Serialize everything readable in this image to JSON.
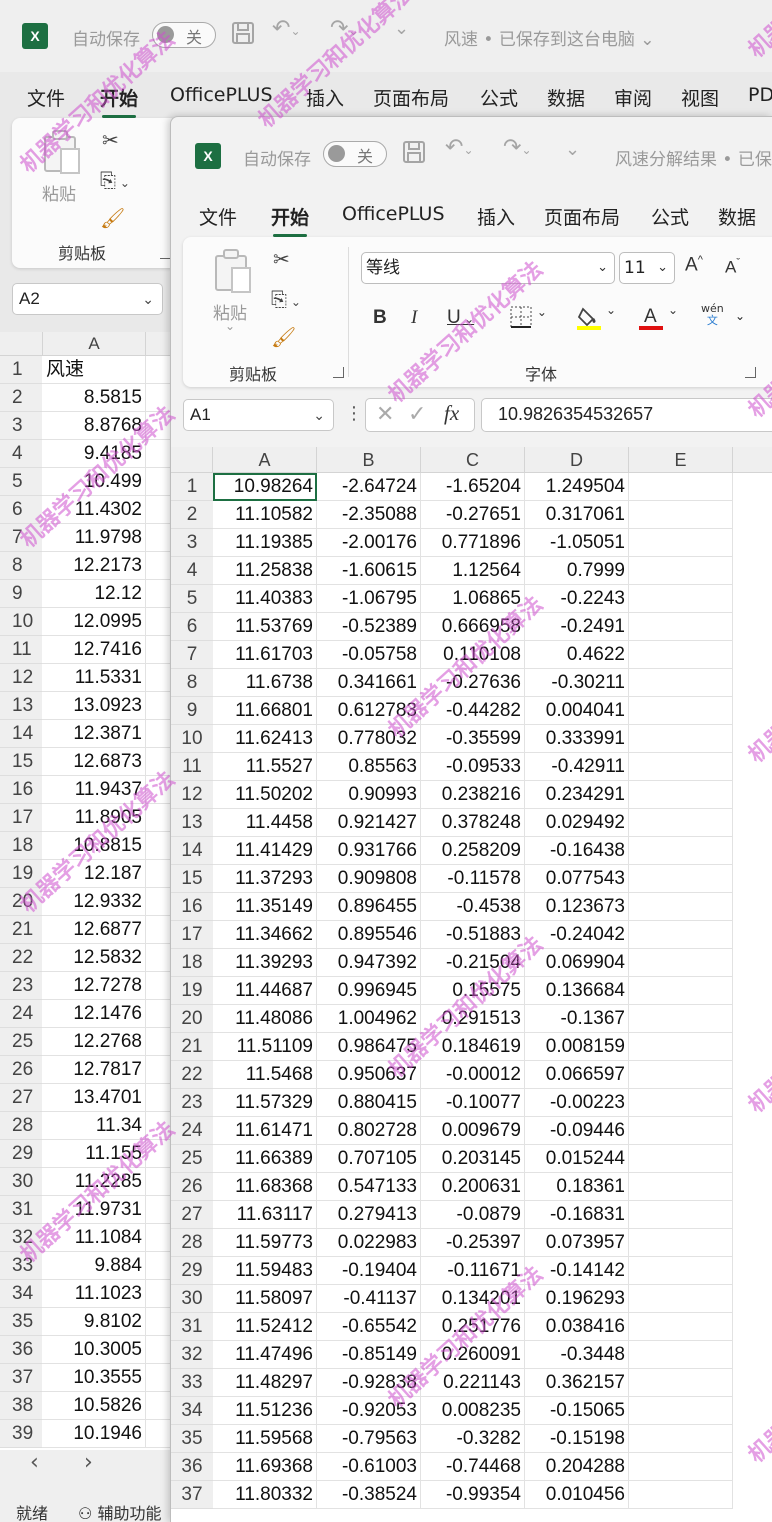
{
  "colors": {
    "excel_green": "#1d6f42",
    "watermark": "#cd50cd"
  },
  "back_window": {
    "autosave_label": "自动保存",
    "autosave_state": "关",
    "doc_title": "风速 • 已保存到这台电脑",
    "menu": [
      "文件",
      "开始",
      "OfficePLUS",
      "插入",
      "页面布局",
      "公式",
      "数据",
      "审阅",
      "视图",
      "PD"
    ],
    "paste_label": "粘贴",
    "clipboard_label": "剪贴板",
    "namebox": "A2",
    "col_header": "A",
    "rows": [
      {
        "n": "1",
        "v": "风速"
      },
      {
        "n": "2",
        "v": "8.5815"
      },
      {
        "n": "3",
        "v": "8.8768"
      },
      {
        "n": "4",
        "v": "9.4185"
      },
      {
        "n": "5",
        "v": "10.499"
      },
      {
        "n": "6",
        "v": "11.4302"
      },
      {
        "n": "7",
        "v": "11.9798"
      },
      {
        "n": "8",
        "v": "12.2173"
      },
      {
        "n": "9",
        "v": "12.12"
      },
      {
        "n": "10",
        "v": "12.0995"
      },
      {
        "n": "11",
        "v": "12.7416"
      },
      {
        "n": "12",
        "v": "11.5331"
      },
      {
        "n": "13",
        "v": "13.0923"
      },
      {
        "n": "14",
        "v": "12.3871"
      },
      {
        "n": "15",
        "v": "12.6873"
      },
      {
        "n": "16",
        "v": "11.9437"
      },
      {
        "n": "17",
        "v": "11.8905"
      },
      {
        "n": "18",
        "v": "10.8815"
      },
      {
        "n": "19",
        "v": "12.187"
      },
      {
        "n": "20",
        "v": "12.9332"
      },
      {
        "n": "21",
        "v": "12.6877"
      },
      {
        "n": "22",
        "v": "12.5832"
      },
      {
        "n": "23",
        "v": "12.7278"
      },
      {
        "n": "24",
        "v": "12.1476"
      },
      {
        "n": "25",
        "v": "12.2768"
      },
      {
        "n": "26",
        "v": "12.7817"
      },
      {
        "n": "27",
        "v": "13.4701"
      },
      {
        "n": "28",
        "v": "11.34"
      },
      {
        "n": "29",
        "v": "11.155"
      },
      {
        "n": "30",
        "v": "11.2285"
      },
      {
        "n": "31",
        "v": "11.9731"
      },
      {
        "n": "32",
        "v": "11.1084"
      },
      {
        "n": "33",
        "v": "9.884"
      },
      {
        "n": "34",
        "v": "11.1023"
      },
      {
        "n": "35",
        "v": "9.8102"
      },
      {
        "n": "36",
        "v": "10.3005"
      },
      {
        "n": "37",
        "v": "10.3555"
      },
      {
        "n": "38",
        "v": "10.5826"
      },
      {
        "n": "39",
        "v": "10.1946"
      }
    ],
    "status_ready": "就绪",
    "status_accessibility": "辅助功能"
  },
  "front_window": {
    "autosave_label": "自动保存",
    "autosave_state": "关",
    "doc_title": "风速分解结果 • 已保",
    "menu": [
      "文件",
      "开始",
      "OfficePLUS",
      "插入",
      "页面布局",
      "公式",
      "数据"
    ],
    "paste_label": "粘贴",
    "clipboard_label": "剪贴板",
    "font_label": "字体",
    "font_name": "等线",
    "font_size": "11",
    "phonetic_top": "wén",
    "phonetic_bottom": "文",
    "namebox": "A1",
    "fx_label": "fx",
    "formula_value": "10.9826354532657",
    "columns": [
      "A",
      "B",
      "C",
      "D",
      "E"
    ],
    "rows": [
      [
        "1",
        "10.98264",
        "-2.64724",
        "-1.65204",
        "1.249504"
      ],
      [
        "2",
        "11.10582",
        "-2.35088",
        "-0.27651",
        "0.317061"
      ],
      [
        "3",
        "11.19385",
        "-2.00176",
        "0.771896",
        "-1.05051"
      ],
      [
        "4",
        "11.25838",
        "-1.60615",
        "1.12564",
        "0.7999"
      ],
      [
        "5",
        "11.40383",
        "-1.06795",
        "1.06865",
        "-0.2243"
      ],
      [
        "6",
        "11.53769",
        "-0.52389",
        "0.666958",
        "-0.2491"
      ],
      [
        "7",
        "11.61703",
        "-0.05758",
        "0.110108",
        "0.4622"
      ],
      [
        "8",
        "11.6738",
        "0.341661",
        "-0.27636",
        "-0.30211"
      ],
      [
        "9",
        "11.66801",
        "0.612783",
        "-0.44282",
        "0.004041"
      ],
      [
        "10",
        "11.62413",
        "0.778032",
        "-0.35599",
        "0.333991"
      ],
      [
        "11",
        "11.5527",
        "0.85563",
        "-0.09533",
        "-0.42911"
      ],
      [
        "12",
        "11.50202",
        "0.90993",
        "0.238216",
        "0.234291"
      ],
      [
        "13",
        "11.4458",
        "0.921427",
        "0.378248",
        "0.029492"
      ],
      [
        "14",
        "11.41429",
        "0.931766",
        "0.258209",
        "-0.16438"
      ],
      [
        "15",
        "11.37293",
        "0.909808",
        "-0.11578",
        "0.077543"
      ],
      [
        "16",
        "11.35149",
        "0.896455",
        "-0.4538",
        "0.123673"
      ],
      [
        "17",
        "11.34662",
        "0.895546",
        "-0.51883",
        "-0.24042"
      ],
      [
        "18",
        "11.39293",
        "0.947392",
        "-0.21504",
        "0.069904"
      ],
      [
        "19",
        "11.44687",
        "0.996945",
        "0.15575",
        "0.136684"
      ],
      [
        "20",
        "11.48086",
        "1.004962",
        "0.291513",
        "-0.1367"
      ],
      [
        "21",
        "11.51109",
        "0.986475",
        "0.184619",
        "0.008159"
      ],
      [
        "22",
        "11.5468",
        "0.950637",
        "-0.00012",
        "0.066597"
      ],
      [
        "23",
        "11.57329",
        "0.880415",
        "-0.10077",
        "-0.00223"
      ],
      [
        "24",
        "11.61471",
        "0.802728",
        "0.009679",
        "-0.09446"
      ],
      [
        "25",
        "11.66389",
        "0.707105",
        "0.203145",
        "0.015244"
      ],
      [
        "26",
        "11.68368",
        "0.547133",
        "0.200631",
        "0.18361"
      ],
      [
        "27",
        "11.63117",
        "0.279413",
        "-0.0879",
        "-0.16831"
      ],
      [
        "28",
        "11.59773",
        "0.022983",
        "-0.25397",
        "0.073957"
      ],
      [
        "29",
        "11.59483",
        "-0.19404",
        "-0.11671",
        "-0.14142"
      ],
      [
        "30",
        "11.58097",
        "-0.41137",
        "0.134201",
        "0.196293"
      ],
      [
        "31",
        "11.52412",
        "-0.65542",
        "0.251776",
        "0.038416"
      ],
      [
        "32",
        "11.47496",
        "-0.85149",
        "0.260091",
        "-0.3448"
      ],
      [
        "33",
        "11.48297",
        "-0.92838",
        "0.221143",
        "0.362157"
      ],
      [
        "34",
        "11.51236",
        "-0.92053",
        "0.008235",
        "-0.15065"
      ],
      [
        "35",
        "11.59568",
        "-0.79563",
        "-0.3282",
        "-0.15198"
      ],
      [
        "36",
        "11.69368",
        "-0.61003",
        "-0.74468",
        "0.204288"
      ],
      [
        "37",
        "11.80332",
        "-0.38524",
        "-0.99354",
        "0.010456"
      ]
    ]
  },
  "watermark_text": "机器学习和优化算法",
  "watermark_edge_text": "机器学"
}
